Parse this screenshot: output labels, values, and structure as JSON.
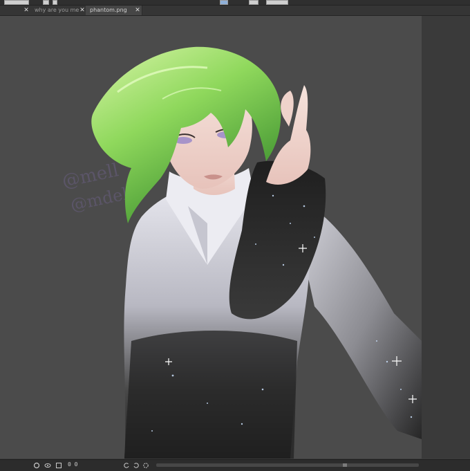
{
  "tabs": [
    {
      "label": "why are you me",
      "active": false
    },
    {
      "label": "phantom.png",
      "active": true
    }
  ],
  "statusbar": {
    "zoom": "0 0"
  },
  "canvas": {
    "background": "#4b4b4b",
    "watermark": [
      "@mell",
      "@mdel"
    ]
  }
}
